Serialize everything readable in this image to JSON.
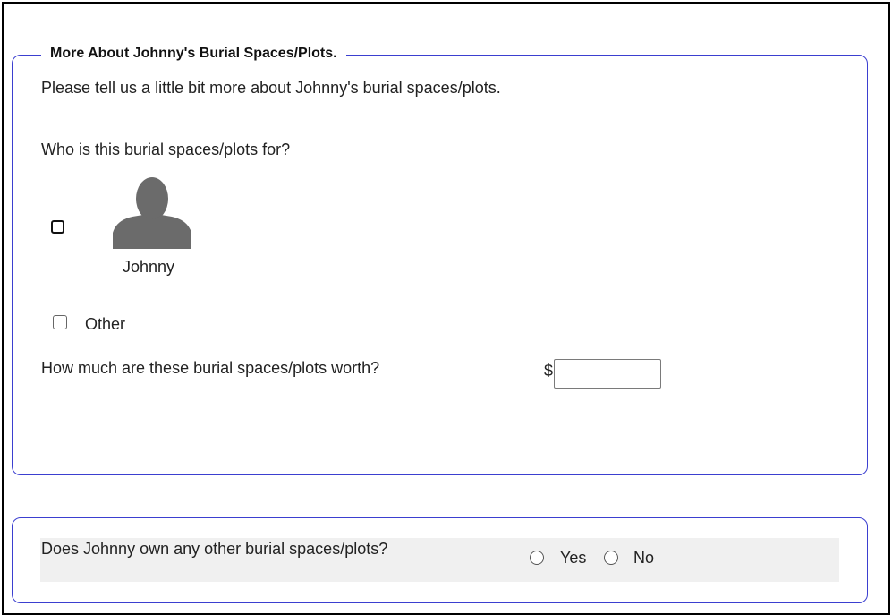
{
  "section1": {
    "legend": "More About Johnny's Burial Spaces/Plots.",
    "intro": "Please tell us a little bit more about Johnny's burial spaces/plots.",
    "who_question": "Who is this burial spaces/plots for?",
    "person": {
      "name": "Johnny",
      "icon": "person-avatar-icon",
      "checked": false
    },
    "other": {
      "label": "Other",
      "checked": false
    },
    "worth_question": "How much are these burial spaces/plots worth?",
    "currency_symbol": "$",
    "worth_value": ""
  },
  "section2": {
    "question": "Does Johnny own any other burial spaces/plots?",
    "options": [
      {
        "label": "Yes",
        "selected": false
      },
      {
        "label": "No",
        "selected": false
      }
    ]
  },
  "colors": {
    "panel_border": "#3b3fd0",
    "row_background": "#f0f0f0",
    "avatar_fill": "#6b6b6b"
  }
}
